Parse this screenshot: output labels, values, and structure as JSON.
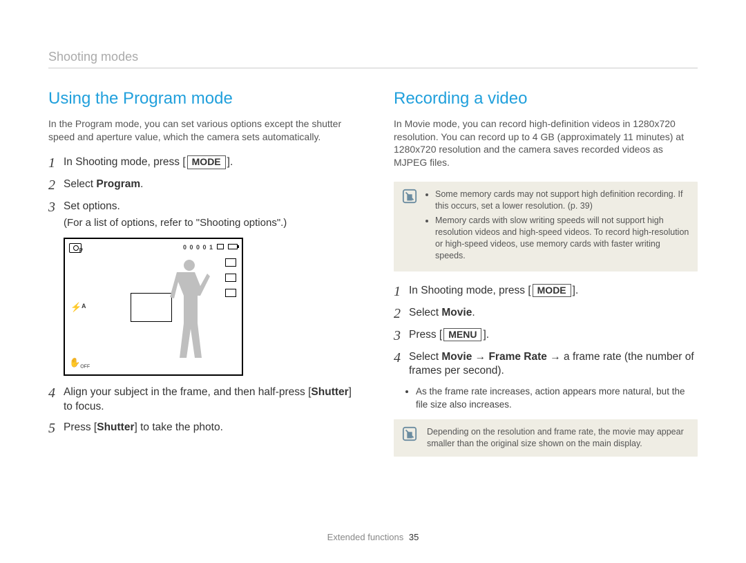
{
  "breadcrumb": "Shooting modes",
  "left": {
    "heading": "Using the Program mode",
    "intro": "In the Program mode, you can set various options except the shutter speed and aperture value, which the camera sets automatically.",
    "step1_pre": "In Shooting mode, press [",
    "step1_btn": "MODE",
    "step1_post": "].",
    "step2_pre": "Select ",
    "step2_bold": "Program",
    "step2_post": ".",
    "step3_line1": "Set options.",
    "step3_line2": "(For a list of options, refer to \"Shooting options\".)",
    "step4_pre": "Align your subject in the frame, and then half-press [",
    "step4_bold": "Shutter",
    "step4_post": "] to focus.",
    "step5_pre": "Press [",
    "step5_bold": "Shutter",
    "step5_post": "] to take the photo.",
    "camera": {
      "counter": "0 0 0 0 1",
      "flash": "⚡ᴬ",
      "hand": "✋",
      "off": "OFF"
    }
  },
  "right": {
    "heading": "Recording a video",
    "intro": "In Movie mode, you can record high-definition videos in 1280x720 resolution. You can record up to 4 GB (approximately 11 minutes) at 1280x720 resolution and the camera saves recorded videos as MJPEG files.",
    "note1_a": "Some memory cards may not support high definition recording. If this occurs, set a lower resolution. (p. 39)",
    "note1_b": "Memory cards with slow writing speeds will not support high resolution videos and high-speed videos. To record high-resolution or high-speed videos, use memory cards with faster writing speeds.",
    "step1_pre": "In Shooting mode, press [",
    "step1_btn": "MODE",
    "step1_post": "].",
    "step2_pre": "Select ",
    "step2_bold": "Movie",
    "step2_post": ".",
    "step3_pre": "Press [",
    "step3_btn": "MENU",
    "step3_post": "].",
    "step4_pre": "Select ",
    "step4_b1": "Movie",
    "step4_arrow1": " → ",
    "step4_b2": "Frame Rate",
    "step4_arrow2": " → ",
    "step4_post": "a frame rate (the number of frames per second).",
    "sub_bullet": "As the frame rate increases, action appears more natural, but the file size also increases.",
    "note2": "Depending on the resolution and frame rate, the movie may appear smaller than the original size shown on the main display."
  },
  "footer": {
    "label": "Extended functions",
    "page": "35"
  }
}
